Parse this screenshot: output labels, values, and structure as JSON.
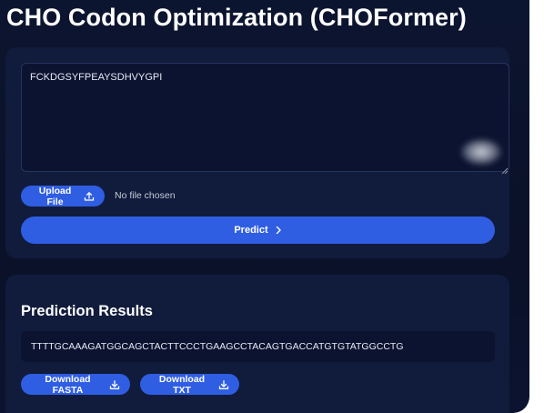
{
  "header": {
    "title": "CHO Codon Optimization (CHOFormer)"
  },
  "input": {
    "sequence_value": "FCKDGSYFPEAYSDHVYGPI",
    "upload_label": "Upload File",
    "file_status": "No file chosen",
    "predict_label": "Predict"
  },
  "results": {
    "heading": "Prediction Results",
    "sequence": "TTTTGCAAAGATGGCAGCTACTTCCCTGAAGCCTACAGTGACCATGTGTATGGCCTG",
    "download_fasta_label": "Download FASTA",
    "download_txt_label": "Download TXT"
  },
  "icons": {
    "upload": "upload-icon",
    "chevron": "chevron-right-icon",
    "download": "download-icon"
  },
  "colors": {
    "background": "#0a1128",
    "card": "#111b3b",
    "accent": "#2f5ee3",
    "text": "#ffffff"
  }
}
